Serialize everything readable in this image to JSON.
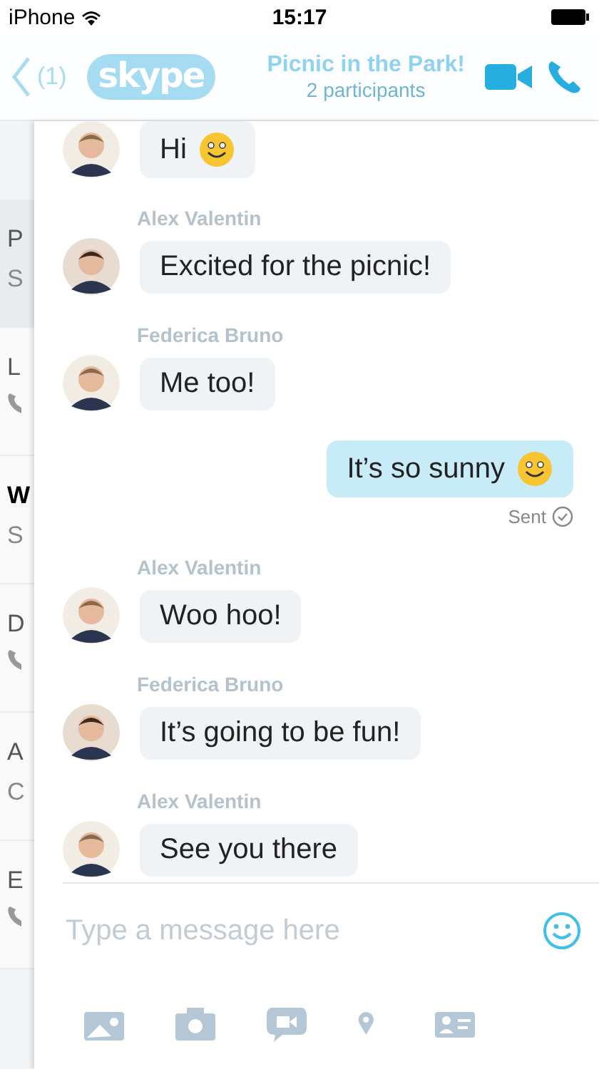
{
  "status_bar": {
    "carrier": "iPhone",
    "time": "15:17"
  },
  "header": {
    "back_count": "(1)",
    "logo": "skype",
    "title": "Picnic in the Park!",
    "subtitle": "2 participants"
  },
  "background_list": [
    {
      "title": "P",
      "subtitle": "S",
      "selected": true,
      "bold": false,
      "kind": "text"
    },
    {
      "title": "L",
      "selected": false,
      "bold": false,
      "kind": "phone"
    },
    {
      "title": "W",
      "subtitle": "S",
      "selected": false,
      "bold": true,
      "kind": "text"
    },
    {
      "title": "D",
      "selected": false,
      "bold": false,
      "kind": "phone"
    },
    {
      "title": "A",
      "subtitle": "C",
      "selected": false,
      "bold": false,
      "kind": "text"
    },
    {
      "title": "E",
      "selected": false,
      "bold": false,
      "kind": "phone"
    }
  ],
  "messages": [
    {
      "outgoing": false,
      "text": "Hi",
      "emoticon": true
    },
    {
      "outgoing": false,
      "sender": "Alex Valentin",
      "text": "Excited for the picnic!",
      "emoticon": false
    },
    {
      "outgoing": false,
      "sender": "Federica Bruno",
      "text": "Me too!",
      "emoticon": false
    },
    {
      "outgoing": true,
      "text": "It’s so sunny",
      "emoticon": true,
      "status": "Sent"
    },
    {
      "outgoing": false,
      "sender": "Alex Valentin",
      "text": "Woo hoo!",
      "emoticon": false
    },
    {
      "outgoing": false,
      "sender": "Federica Bruno",
      "text": "It’s going to be fun!",
      "emoticon": false
    },
    {
      "outgoing": false,
      "sender": "Alex Valentin",
      "text": "See you there",
      "emoticon": false
    }
  ],
  "composer": {
    "placeholder": "Type a message here"
  }
}
